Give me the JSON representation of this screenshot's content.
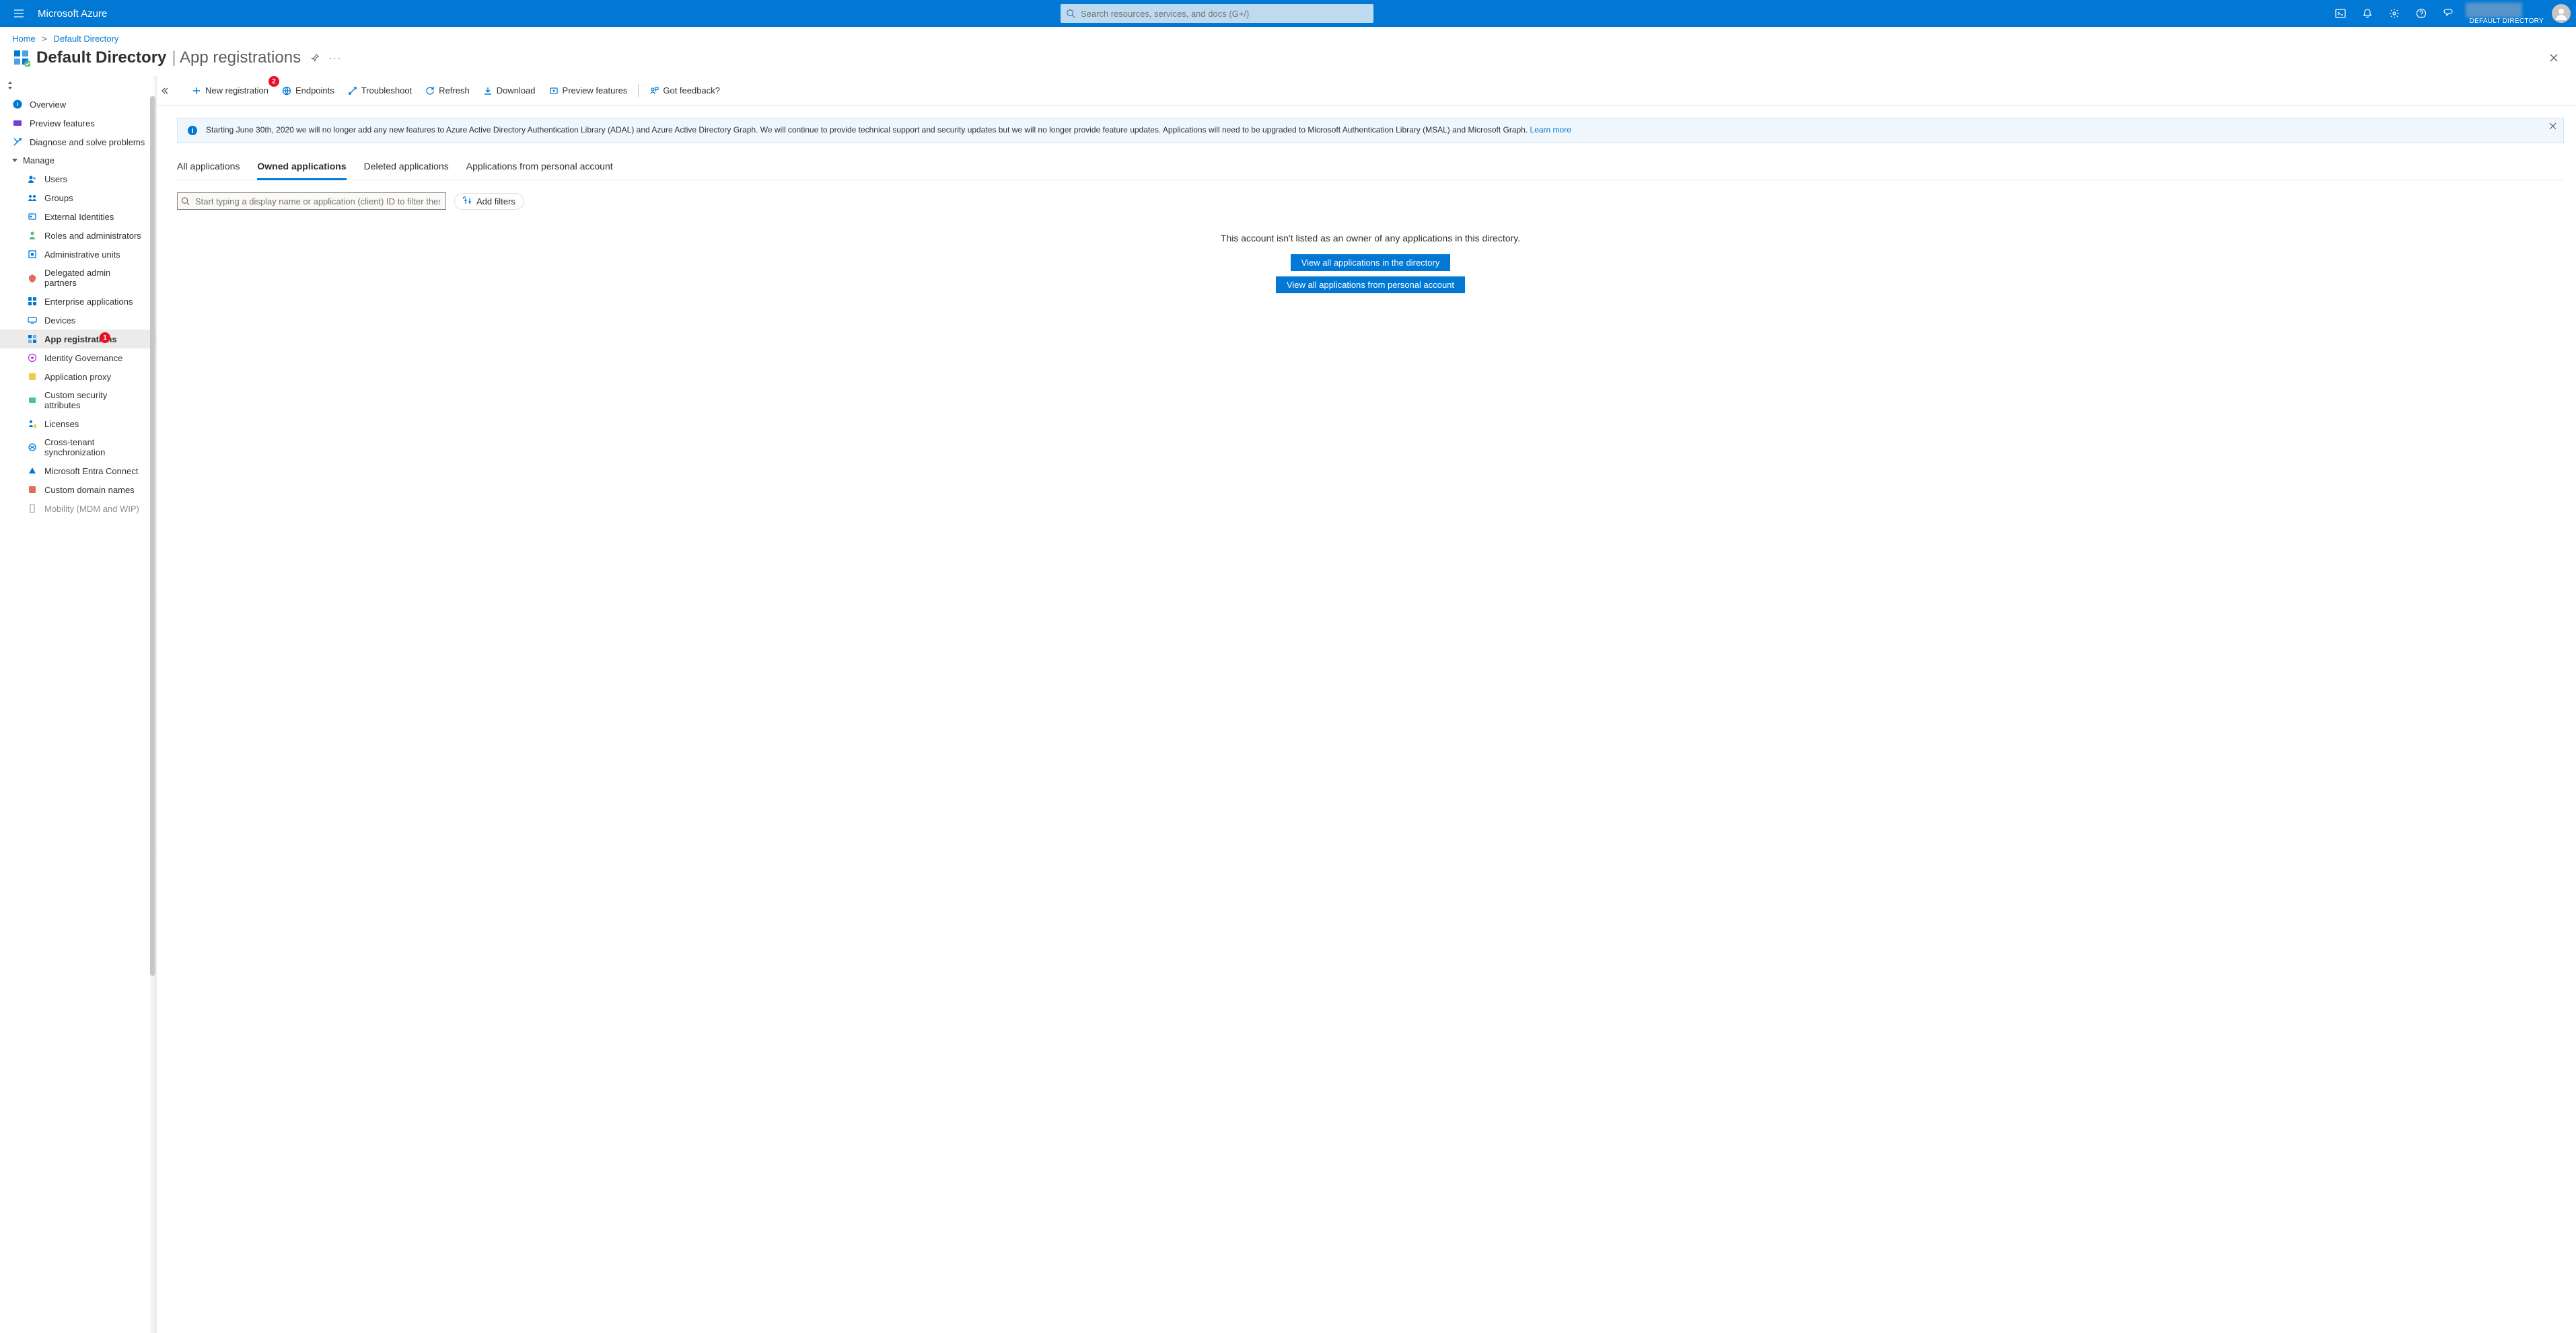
{
  "header": {
    "brand": "Microsoft Azure",
    "search_placeholder": "Search resources, services, and docs (G+/)",
    "tenant": "DEFAULT DIRECTORY"
  },
  "breadcrumb": {
    "home": "Home",
    "current": "Default Directory"
  },
  "title": {
    "main": "Default Directory",
    "sub": "App registrations"
  },
  "commandbar": {
    "new_registration": "New registration",
    "new_registration_badge": "2",
    "endpoints": "Endpoints",
    "troubleshoot": "Troubleshoot",
    "refresh": "Refresh",
    "download": "Download",
    "preview_features": "Preview features",
    "got_feedback": "Got feedback?"
  },
  "banner": {
    "text": "Starting June 30th, 2020 we will no longer add any new features to Azure Active Directory Authentication Library (ADAL) and Azure Active Directory Graph. We will continue to provide technical support and security updates but we will no longer provide feature updates. Applications will need to be upgraded to Microsoft Authentication Library (MSAL) and Microsoft Graph. ",
    "link": "Learn more"
  },
  "sidebar": {
    "overview": "Overview",
    "preview_features": "Preview features",
    "diagnose": "Diagnose and solve problems",
    "manage": "Manage",
    "users": "Users",
    "groups": "Groups",
    "external_identities": "External Identities",
    "roles": "Roles and administrators",
    "admin_units": "Administrative units",
    "delegated": "Delegated admin partners",
    "enterprise_apps": "Enterprise applications",
    "devices": "Devices",
    "app_registrations": "App registrations",
    "app_registrations_badge": "1",
    "identity_gov": "Identity Governance",
    "app_proxy": "Application proxy",
    "custom_sec": "Custom security attributes",
    "licenses": "Licenses",
    "cross_tenant": "Cross-tenant synchronization",
    "entra_connect": "Microsoft Entra Connect",
    "custom_domains": "Custom domain names",
    "mobility": "Mobility (MDM and WIP)"
  },
  "tabs": {
    "all": "All applications",
    "owned": "Owned applications",
    "deleted": "Deleted applications",
    "personal": "Applications from personal account"
  },
  "filter": {
    "placeholder": "Start typing a display name or application (client) ID to filter these r...",
    "add_filters": "Add filters"
  },
  "empty": {
    "message": "This account isn't listed as an owner of any applications in this directory.",
    "btn_directory": "View all applications in the directory",
    "btn_personal": "View all applications from personal account"
  }
}
